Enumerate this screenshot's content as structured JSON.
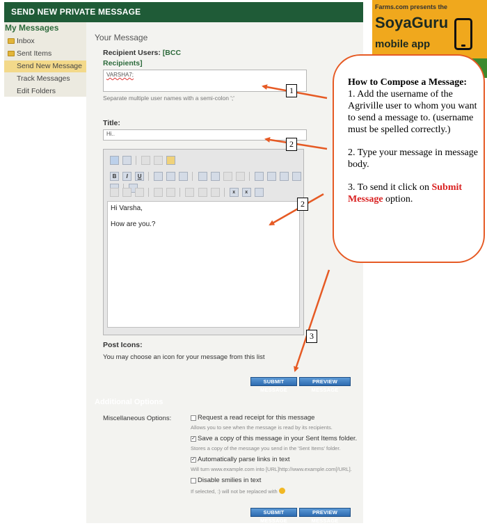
{
  "header": {
    "title": "SEND NEW PRIVATE MESSAGE"
  },
  "sidebar": {
    "title": "My Messages",
    "items": [
      {
        "label": "Inbox"
      },
      {
        "label": "Sent Items"
      },
      {
        "label": "Send New Message"
      },
      {
        "label": "Track Messages"
      },
      {
        "label": "Edit Folders"
      }
    ]
  },
  "form": {
    "section_title": "Your Message",
    "recipient_label": "Recipient Users:",
    "bcc_link": "[BCC Recipients]",
    "bcc_line1": "[BCC",
    "bcc_line2": "Recipients]",
    "recipient_value": "VARSHA7;",
    "recipient_hint": "Separate multiple user names with a semi-colon ';'",
    "title_label": "Title:",
    "title_value": "Hi..",
    "message_line1": "Hi Varsha,",
    "message_line2": "How are you.?",
    "post_icons_label": "Post Icons:",
    "post_icons_hint": "You may choose an icon for your message from this list",
    "submit_button": "SUBMIT MESSAGE",
    "preview_button": "PREVIEW MESSAGE"
  },
  "toolbar": {
    "bold": "B",
    "italic": "I",
    "underline": "U",
    "subscript": "x",
    "superscript": "x"
  },
  "options": {
    "section_title": "Additional Options",
    "misc_label": "Miscellaneous Options:",
    "items": [
      {
        "label": "Request a read receipt for this message",
        "hint": "Allows you to see when the message is read by its recipients.",
        "checked": false
      },
      {
        "label": "Save a copy of this message in your Sent Items folder.",
        "hint": "Stores a copy of the message you send in the 'Sent Items' folder.",
        "checked": true
      },
      {
        "label": "Automatically parse links in text",
        "hint": "Will turn www.example.com into [URL]http://www.example.com[/URL].",
        "checked": true
      },
      {
        "label": "Disable smilies in text",
        "hint": "If selected, :) will not be replaced with",
        "checked": false
      }
    ]
  },
  "ad": {
    "small_text": "Farms.com presents the",
    "brand": "SoyaGuru",
    "subtitle": "mobile app"
  },
  "callout": {
    "title": "How to Compose a Message:",
    "step1": "1. Add the username of the Agriville user to whom you want to send a message to. (username must be spelled correctly.)",
    "step2": "2. Type your message in message body.",
    "step3_prefix": "3. To send it click on",
    "step3_highlight": "Submit Message",
    "step3_suffix": "option."
  },
  "markers": {
    "one": "1",
    "two": "2",
    "two_b": "2",
    "three": "3"
  },
  "colors": {
    "header": "#1f5b37",
    "accent": "#e65a24",
    "button": "#2e6bb0",
    "active_item": "#f3d98a"
  }
}
